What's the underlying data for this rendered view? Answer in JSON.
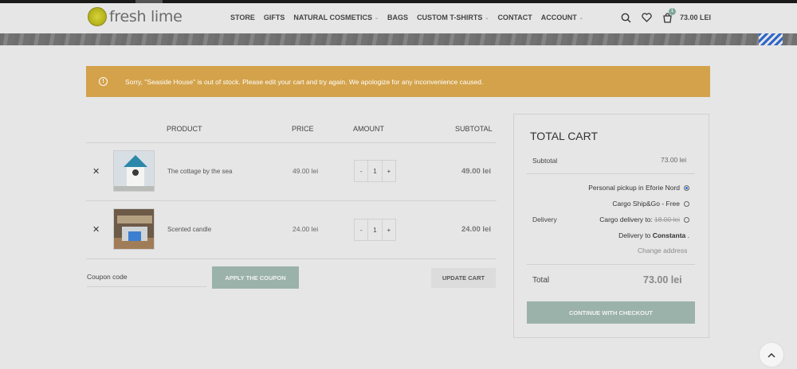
{
  "brand": {
    "name": "fresh lime"
  },
  "nav": {
    "items": [
      {
        "label": "STORE",
        "dropdown": false
      },
      {
        "label": "GIFTS",
        "dropdown": false
      },
      {
        "label": "NATURAL COSMETICS",
        "dropdown": true
      },
      {
        "label": "BAGS",
        "dropdown": false
      },
      {
        "label": "CUSTOM T-SHIRTS",
        "dropdown": true
      },
      {
        "label": "CONTACT",
        "dropdown": false
      },
      {
        "label": "ACCOUNT",
        "dropdown": true
      }
    ],
    "icons": [
      "search-icon",
      "heart-icon",
      "cart-icon"
    ],
    "cart_count": "1",
    "cart_total": "73.00 LEI"
  },
  "notice": {
    "text": "Sorry, \"Seaside House\" is out of stock. Please edit your cart and try again. We apologize for any inconvenience caused.",
    "color": "#d3a24a"
  },
  "cart": {
    "columns": {
      "product": "PRODUCT",
      "price": "PRICE",
      "amount": "AMOUNT",
      "subtotal": "SUBTOTAL"
    },
    "items": [
      {
        "name": "The cottage by the sea",
        "price": "49.00 lei",
        "qty": "1",
        "subtotal": "49.00 lei"
      },
      {
        "name": "Scented candle",
        "price": "24.00 lei",
        "qty": "1",
        "subtotal": "24.00 lei"
      }
    ],
    "stepper": {
      "minus": "-",
      "plus": "+"
    },
    "remove_symbol": "✕",
    "coupon_placeholder": "Coupon code",
    "apply_coupon": "APPLY THE COUPON",
    "update_cart": "UPDATE CART"
  },
  "totals": {
    "title": "TOTAL CART",
    "subtotal_label": "Subtotal",
    "subtotal_value": "73.00 lei",
    "delivery_label": "Delivery",
    "options": [
      {
        "label": "Personal pickup in Eforie Nord",
        "selected": true
      },
      {
        "label": "Cargo Ship&Go - Free",
        "selected": false
      },
      {
        "label": "Cargo delivery to:",
        "strike_price": "18.00 lei",
        "selected": false
      }
    ],
    "delivery_to_prefix": "Delivery to",
    "delivery_to_city": "Constanta",
    "delivery_to_suffix": ".",
    "change_address": "Change address",
    "total_label": "Total",
    "total_value": "73.00 lei",
    "checkout": "CONTINUE WITH CHECKOUT",
    "accent": "#9bb2aa"
  }
}
